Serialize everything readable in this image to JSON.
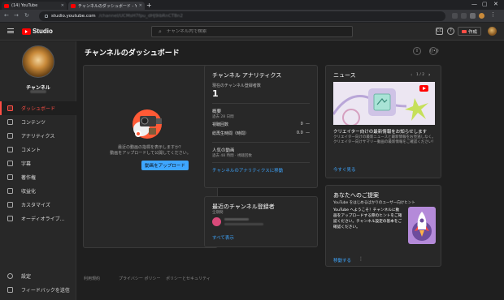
{
  "browser": {
    "tabs": [
      {
        "title": "(14) YouTube"
      },
      {
        "title": "チャンネルのダッシュボード - YouTube Studio"
      }
    ],
    "new_tab": "+",
    "url": "studio.youtube.com",
    "url_path": "/channel/UCMsH7fpu_dHJ9ibRnCTBn2",
    "window_controls": [
      "—",
      "▢",
      "✕"
    ]
  },
  "header": {
    "logo_text": "Studio",
    "search_placeholder": "チャンネル内で検索",
    "create_label": "作成"
  },
  "sidebar": {
    "channel_name": "チャンネル",
    "items": [
      {
        "label": "ダッシュボード",
        "icon": "dashboard-icon",
        "active": true
      },
      {
        "label": "コンテンツ",
        "icon": "content-icon"
      },
      {
        "label": "アナリティクス",
        "icon": "analytics-icon"
      },
      {
        "label": "コメント",
        "icon": "comment-icon"
      },
      {
        "label": "字幕",
        "icon": "subtitles-icon"
      },
      {
        "label": "著作権",
        "icon": "copyright-icon"
      },
      {
        "label": "収益化",
        "icon": "monetization-icon"
      },
      {
        "label": "カスタマイズ",
        "icon": "customize-icon"
      },
      {
        "label": "オーディオライブ...",
        "icon": "audio-library-icon"
      }
    ],
    "bottom_items": [
      {
        "label": "設定",
        "icon": "settings-icon"
      },
      {
        "label": "フィードバックを送信",
        "icon": "feedback-icon"
      }
    ]
  },
  "main": {
    "title": "チャンネルのダッシュボード",
    "upload_card": {
      "text_line1": "最近の動画の指標を表示しますか？",
      "text_line2": "動画をアップロードして公開してください。",
      "button": "動画をアップロード"
    },
    "analytics_card": {
      "title": "チャンネル アナリティクス",
      "subscribers_label": "現在のチャンネル登録者数",
      "subscribers_value": "1",
      "summary_label": "概要",
      "summary_period": "過去 28 日間",
      "rows": [
        {
          "label": "視聴回数",
          "value": "0",
          "trend": "—"
        },
        {
          "label": "総再生時間（時間）",
          "value": "0.0",
          "trend": "—"
        }
      ],
      "top_videos_label": "人気の動画",
      "top_videos_period": "過去 48 時間 · 視聴回数",
      "link": "チャンネルのアナリティクスに移動"
    },
    "subscribers_card": {
      "title": "最近のチャンネル登録者",
      "period": "全期間",
      "link": "すべて表示"
    },
    "news_card": {
      "title": "ニュース",
      "pager": "1 / 2",
      "headline": "クリエイター向けの最新情報をお知らせします",
      "body": "クリエイター向けの最新ニュースと最新情報をお見逃しなく。クリエイター向けサマリー動画の最新情報をご確認ください！",
      "link": "今すぐ見る"
    },
    "ideas_card": {
      "title": "あなたへのご提案",
      "subtitle": "YouTube をはじめるばかりのユーザー向けヒント",
      "body": "YouTube へようこそ！チャンネルに動画をアップロードする際のヒントをご確認ください。チャンネル設定の基本をご確認ください。",
      "link": "移動する",
      "more": "⋮"
    },
    "footer_links": [
      "利用規約",
      "プライバシー ポリシー",
      "ポリシーとセキュリティ"
    ]
  },
  "colors": {
    "accent_red": "#ff4e45",
    "youtube_red": "#ff0000",
    "link_blue": "#3ea6ff",
    "background": "#1f1f1f",
    "surface": "#282828"
  }
}
